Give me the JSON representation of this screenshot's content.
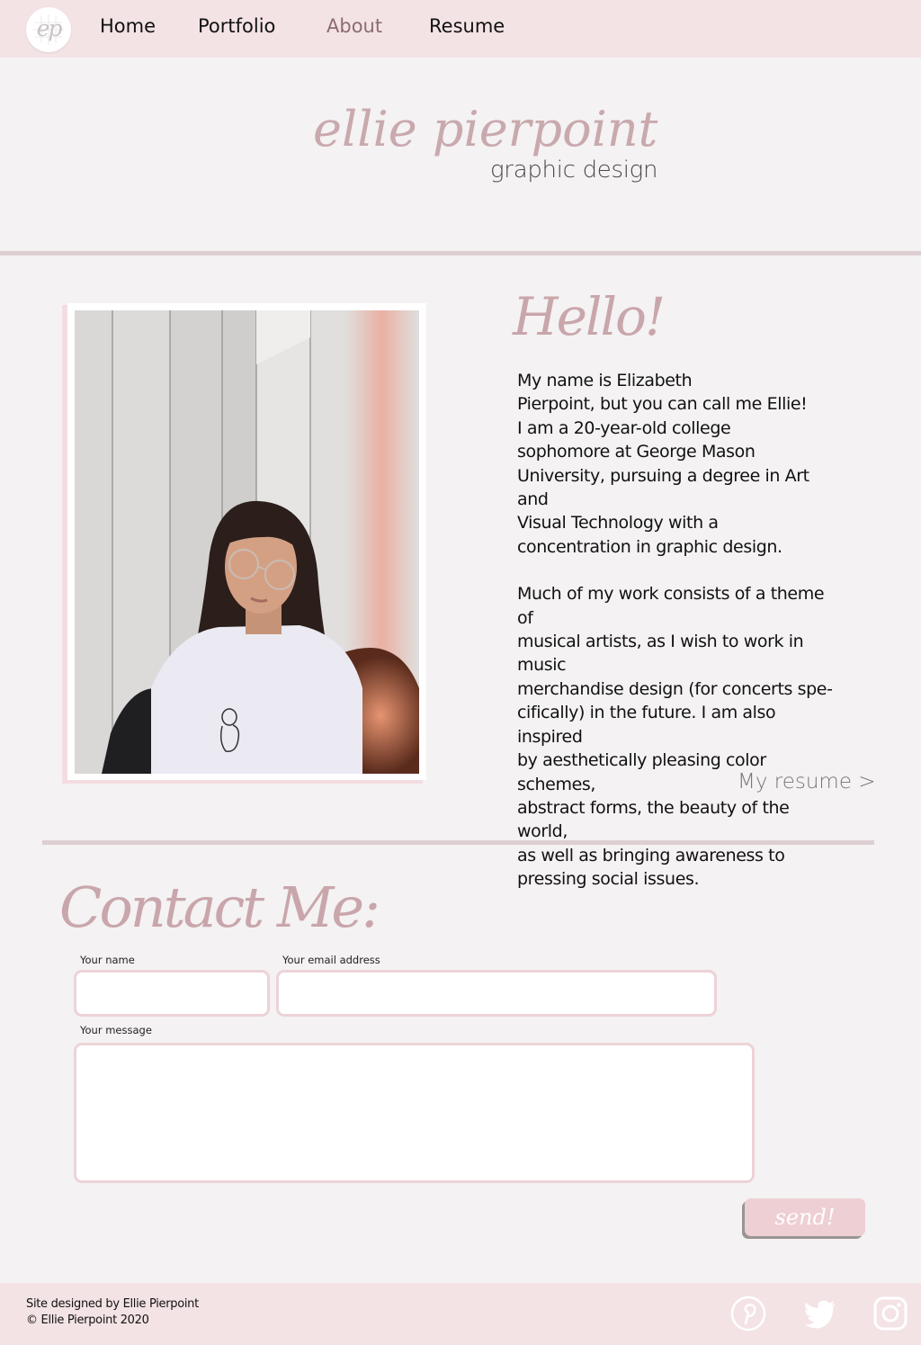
{
  "nav": {
    "logo_text": "ep",
    "links": [
      {
        "label": "Home",
        "active": false
      },
      {
        "label": "Portfolio",
        "active": false
      },
      {
        "label": "About",
        "active": true
      },
      {
        "label": "Resume",
        "active": false
      }
    ]
  },
  "header": {
    "script_name": "ellie pierpoint",
    "subtitle": "graphic design"
  },
  "about": {
    "greeting": "Hello!",
    "paragraphs": [
      "My name is Elizabeth\nPierpoint, but you can call me Ellie!\nI am a 20-year-old college\nsophomore at George Mason\nUniversity, pursuing a degree in Art and\nVisual Technology with a\nconcentration in graphic design.",
      "Much of my work consists of a theme of\nmusical artists, as I wish to work in music\nmerchandise design (for concerts spe-\ncifically) in the future. I am also inspired\nby aesthetically pleasing color schemes,\nabstract forms, the beauty of the world,\nas well as bringing awareness to\npressing social issues."
    ],
    "resume_link": "My resume  >"
  },
  "contact": {
    "title": "Contact Me:",
    "name_label": "Your name",
    "name_value": "",
    "email_label": "Your email address",
    "email_value": "",
    "message_label": "Your message",
    "message_value": "",
    "send_label": "send!"
  },
  "footer": {
    "credit": "Site designed by Ellie Pierpoint",
    "copyright": "© Ellie Pierpoint 2020",
    "social_icons": [
      "pinterest-icon",
      "twitter-icon",
      "instagram-icon"
    ]
  },
  "colors": {
    "nav_bg": "#f3e3e5",
    "page_bg": "#f4f2f3",
    "accent_script": "#c9a6ab",
    "active_link": "#8e6b70",
    "divider": "#ddcfd1",
    "field_border": "#ecd3d7",
    "button_bg": "#eecfd4"
  }
}
